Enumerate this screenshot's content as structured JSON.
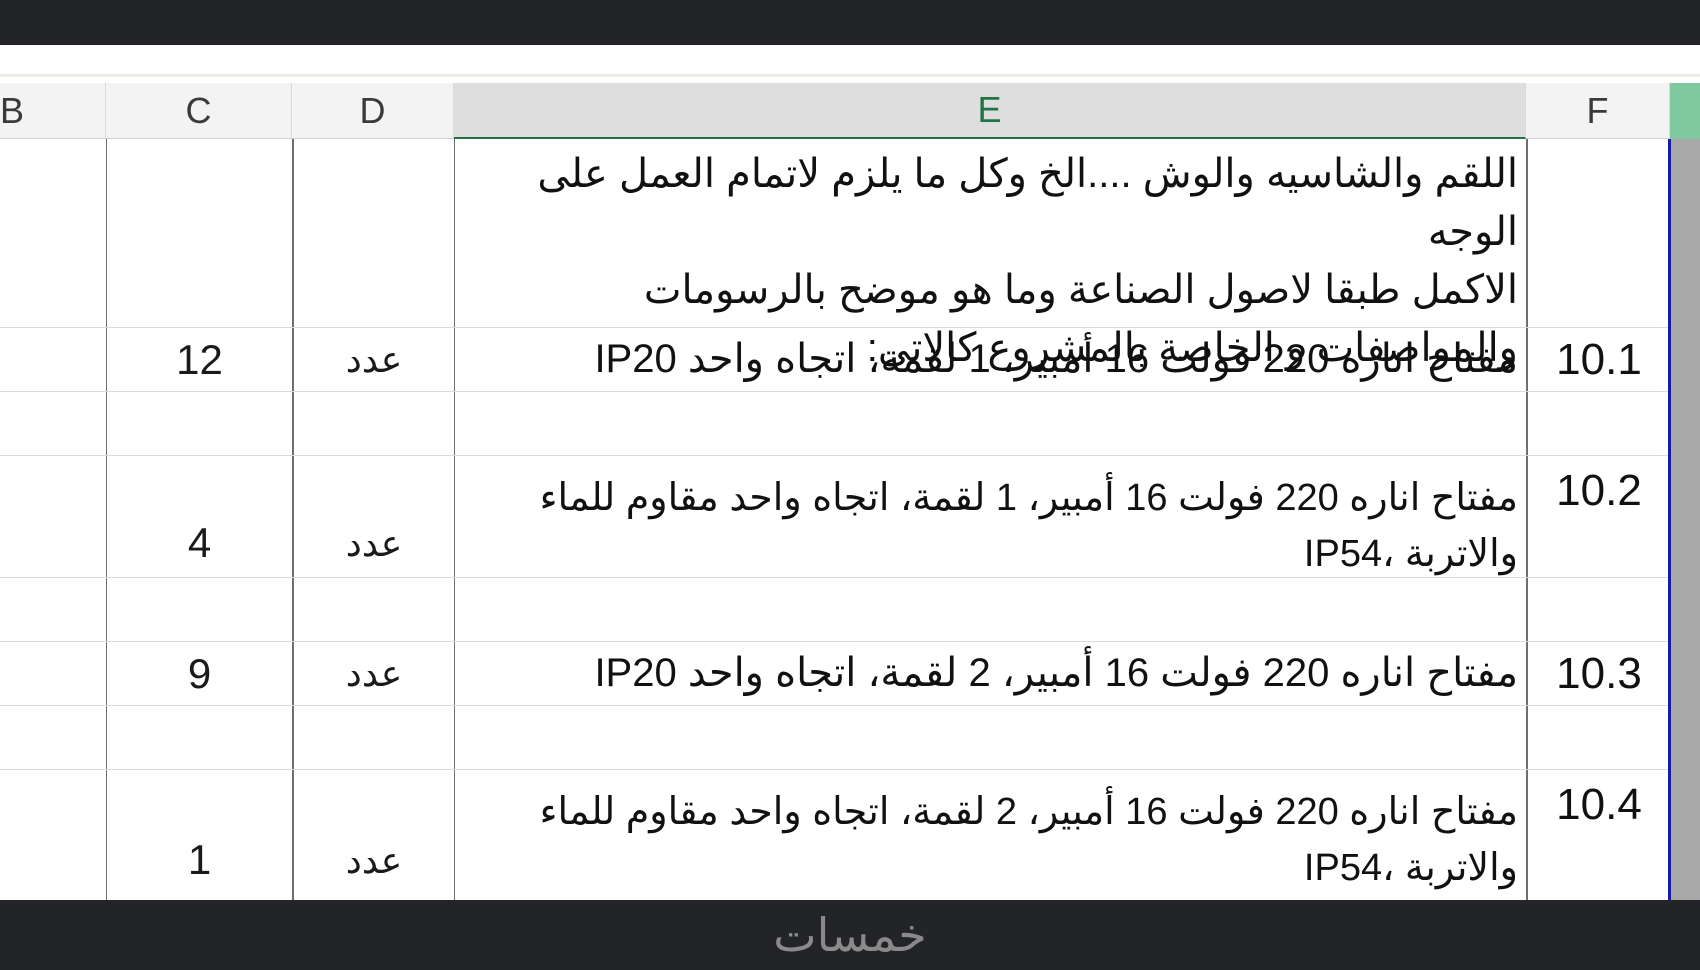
{
  "columns": {
    "b": "B",
    "c": "C",
    "d": "D",
    "e": "E",
    "f": "F"
  },
  "intro_text": "اللقم والشاسيه والوش ....الخ وكل ما يلزم لاتمام العمل على الوجه\nالاكمل طبقا  لاصول الصناعة وما هو موضح بالرسومات\nوالمواصفات و الخاصة بالمشروع  كالاتى:",
  "rows": [
    {
      "item": "10.1",
      "description": "مفتاح اناره 220 فولت 16 أمبير، 1 لقمة، اتجاه واحد IP20",
      "unit": "عدد",
      "qty": "12"
    },
    {
      "item": "10.2",
      "description": "مفتاح اناره 220 فولت 16 أمبير، 1 لقمة، اتجاه واحد مقاوم للماء\nوالاتربة ،IP54",
      "unit": "عدد",
      "qty": "4"
    },
    {
      "item": "10.3",
      "description": "مفتاح اناره 220 فولت 16 أمبير، 2 لقمة، اتجاه واحد IP20",
      "unit": "عدد",
      "qty": "9"
    },
    {
      "item": "10.4",
      "description": "مفتاح اناره 220 فولت 16 أمبير، 2 لقمة، اتجاه واحد مقاوم للماء\nوالاتربة ،IP54",
      "unit": "عدد",
      "qty": "1"
    }
  ],
  "footer": {
    "brand": "خمسات"
  },
  "colors": {
    "selected_header": "#217346",
    "scroll_accent": "#1a1aa0"
  }
}
